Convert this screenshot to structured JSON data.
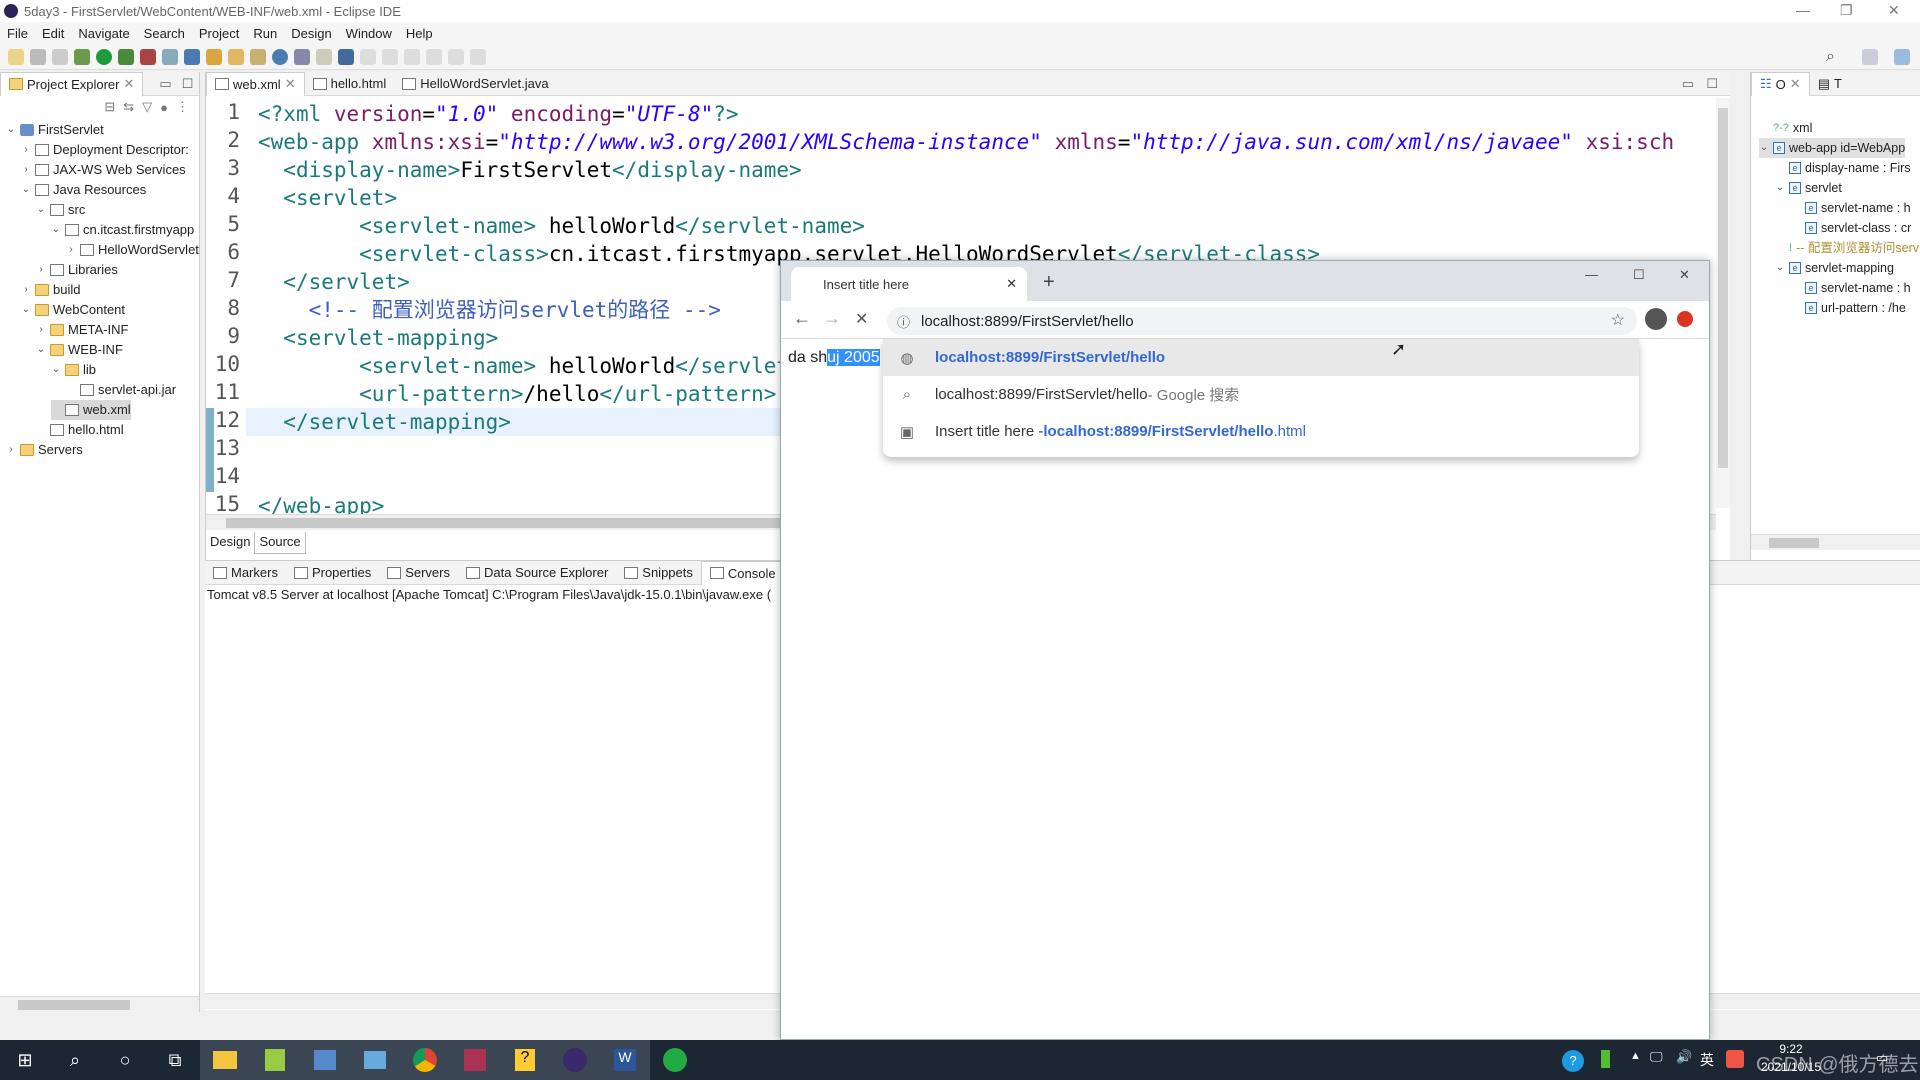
{
  "window": {
    "title": "5day3 - FirstServlet/WebContent/WEB-INF/web.xml - Eclipse IDE"
  },
  "menu": [
    "File",
    "Edit",
    "Navigate",
    "Search",
    "Project",
    "Run",
    "Design",
    "Window",
    "Help"
  ],
  "explorer": {
    "title": "Project Explorer",
    "items": [
      {
        "label": "FirstServlet",
        "depth": 0,
        "expanded": true,
        "icon": "project-icon"
      },
      {
        "label": "Deployment Descriptor:",
        "depth": 1,
        "expanded": false,
        "icon": "descriptor-icon"
      },
      {
        "label": "JAX-WS Web Services",
        "depth": 1,
        "expanded": false,
        "icon": "webservice-icon"
      },
      {
        "label": "Java Resources",
        "depth": 1,
        "expanded": true,
        "icon": "java-resources-icon"
      },
      {
        "label": "src",
        "depth": 2,
        "expanded": true,
        "icon": "package-folder-icon"
      },
      {
        "label": "cn.itcast.firstmyapp",
        "depth": 3,
        "expanded": true,
        "icon": "package-icon"
      },
      {
        "label": "HelloWordServlet",
        "depth": 4,
        "expanded": false,
        "icon": "java-file-icon"
      },
      {
        "label": "Libraries",
        "depth": 2,
        "expanded": false,
        "icon": "library-icon"
      },
      {
        "label": "build",
        "depth": 1,
        "expanded": false,
        "icon": "folder-icon"
      },
      {
        "label": "WebContent",
        "depth": 1,
        "expanded": true,
        "icon": "folder-icon"
      },
      {
        "label": "META-INF",
        "depth": 2,
        "expanded": false,
        "icon": "folder-icon"
      },
      {
        "label": "WEB-INF",
        "depth": 2,
        "expanded": true,
        "icon": "folder-icon"
      },
      {
        "label": "lib",
        "depth": 3,
        "expanded": true,
        "icon": "folder-icon"
      },
      {
        "label": "servlet-api.jar",
        "depth": 4,
        "icon": "jar-icon"
      },
      {
        "label": "web.xml",
        "depth": 3,
        "icon": "xml-file-icon",
        "selected": true
      },
      {
        "label": "hello.html",
        "depth": 2,
        "icon": "html-file-icon"
      },
      {
        "label": "Servers",
        "depth": 0,
        "expanded": false,
        "icon": "folder-icon"
      }
    ]
  },
  "editor": {
    "tabs": [
      {
        "label": "web.xml",
        "active": true
      },
      {
        "label": "hello.html"
      },
      {
        "label": "HelloWordServlet.java"
      }
    ],
    "lines": [
      {
        "n": "1",
        "code": [
          [
            "tg",
            "<?"
          ],
          [
            "tg",
            "xml "
          ],
          [
            "at",
            "version"
          ],
          [
            "tx",
            "="
          ],
          [
            "st",
            "\"1.0\""
          ],
          [
            "tx",
            " "
          ],
          [
            "at",
            "encoding"
          ],
          [
            "tx",
            "="
          ],
          [
            "st",
            "\"UTF-8\""
          ],
          [
            "tg",
            "?>"
          ]
        ]
      },
      {
        "n": "2",
        "code": [
          [
            "tg",
            "<web-app "
          ],
          [
            "at",
            "xmlns:xsi"
          ],
          [
            "tx",
            "="
          ],
          [
            "st",
            "\"http://www.w3.org/2001/XMLSchema-instance\""
          ],
          [
            "tx",
            " "
          ],
          [
            "at",
            "xmlns"
          ],
          [
            "tx",
            "="
          ],
          [
            "st",
            "\"http://java.sun.com/xml/ns/javaee\""
          ],
          [
            "tx",
            " "
          ],
          [
            "at",
            "xsi:sch"
          ]
        ]
      },
      {
        "n": "3",
        "code": [
          [
            "tx",
            "  "
          ],
          [
            "tg",
            "<display-name>"
          ],
          [
            "tx",
            "FirstServlet"
          ],
          [
            "tg",
            "</display-name>"
          ]
        ]
      },
      {
        "n": "4",
        "code": [
          [
            "tx",
            "  "
          ],
          [
            "tg",
            "<servlet>"
          ]
        ]
      },
      {
        "n": "5",
        "code": [
          [
            "tx",
            "        "
          ],
          [
            "tg",
            "<servlet-name>"
          ],
          [
            "tx",
            " helloWorld"
          ],
          [
            "tg",
            "</servlet-name>"
          ]
        ]
      },
      {
        "n": "6",
        "code": [
          [
            "tx",
            "        "
          ],
          [
            "tg",
            "<servlet-class>"
          ],
          [
            "tx",
            "cn.itcast.firstmyapp.servlet.HelloWordServlet"
          ],
          [
            "tg",
            "</servlet-class>"
          ]
        ]
      },
      {
        "n": "7",
        "code": [
          [
            "tx",
            "  "
          ],
          [
            "tg",
            "</servlet>"
          ]
        ]
      },
      {
        "n": "8",
        "code": [
          [
            "tx",
            "    "
          ],
          [
            "cm",
            "<!-- 配置浏览器访问servlet的路径 -->"
          ]
        ]
      },
      {
        "n": "9",
        "code": [
          [
            "tx",
            "  "
          ],
          [
            "tg",
            "<servlet-mapping>"
          ]
        ]
      },
      {
        "n": "10",
        "code": [
          [
            "tx",
            "        "
          ],
          [
            "tg",
            "<servlet-name>"
          ],
          [
            "tx",
            " helloWorld"
          ],
          [
            "tg",
            "</servlet-name>"
          ]
        ]
      },
      {
        "n": "11",
        "code": [
          [
            "tx",
            "        "
          ],
          [
            "tg",
            "<url-pattern>"
          ],
          [
            "tx",
            "/hello"
          ],
          [
            "tg",
            "</url-pattern>"
          ]
        ]
      },
      {
        "n": "12",
        "code": [
          [
            "tx",
            "  "
          ],
          [
            "tg",
            "</servlet-mapping>"
          ]
        ]
      },
      {
        "n": "13",
        "code": []
      },
      {
        "n": "14",
        "code": []
      },
      {
        "n": "15",
        "code": [
          [
            "tg",
            "</web-app>"
          ]
        ]
      }
    ],
    "bottom_tabs": [
      "Design",
      "Source"
    ],
    "active_bottom_tab": "Source"
  },
  "outline": {
    "tabs": [
      "O",
      "T"
    ],
    "items": [
      {
        "label": "xml",
        "depth": 0,
        "icon": "pi-icon"
      },
      {
        "label": "web-app id=WebApp",
        "depth": 0,
        "expanded": true,
        "icon": "element-icon"
      },
      {
        "label": "display-name : Firs",
        "depth": 1,
        "icon": "element-icon"
      },
      {
        "label": "servlet",
        "depth": 1,
        "expanded": true,
        "icon": "element-icon"
      },
      {
        "label": "servlet-name : h",
        "depth": 2,
        "icon": "element-icon"
      },
      {
        "label": "servlet-class : cr",
        "depth": 2,
        "icon": "element-icon"
      },
      {
        "label": "-- 配置浏览器访问serv",
        "depth": 1,
        "icon": "comment-icon"
      },
      {
        "label": "servlet-mapping",
        "depth": 1,
        "expanded": true,
        "icon": "element-icon"
      },
      {
        "label": "servlet-name : h",
        "depth": 2,
        "icon": "element-icon"
      },
      {
        "label": "url-pattern : /he",
        "depth": 2,
        "icon": "element-icon"
      }
    ]
  },
  "bottom": {
    "tabs": [
      "Markers",
      "Properties",
      "Servers",
      "Data Source Explorer",
      "Snippets",
      "Console"
    ],
    "active": "Console",
    "console_line": "Tomcat v8.5 Server at localhost [Apache Tomcat] C:\\Program Files\\Java\\jdk-15.0.1\\bin\\javaw.exe  ("
  },
  "browser": {
    "tab_title": "Insert title here",
    "address": "localhost:8899/FirstServlet/hello",
    "page_text_plain": "da sh",
    "page_text_selected": "uj 2005",
    "suggestions": [
      {
        "icon": "globe-icon",
        "bold": "localhost:8899/FirstServlet/hello",
        "highlighted": true
      },
      {
        "icon": "search-icon",
        "plain": "localhost:8899/FirstServlet/hello",
        "suffix": " - Google 搜索"
      },
      {
        "icon": "page-icon",
        "plain": "Insert title here - ",
        "bold": "localhost:8899/FirstServlet/hello",
        "suffix": ".html"
      }
    ]
  },
  "taskbar": {
    "time": "9:22",
    "date": "2021/10/15",
    "ime": "英",
    "watermark": "CSDN @俄方德去"
  }
}
